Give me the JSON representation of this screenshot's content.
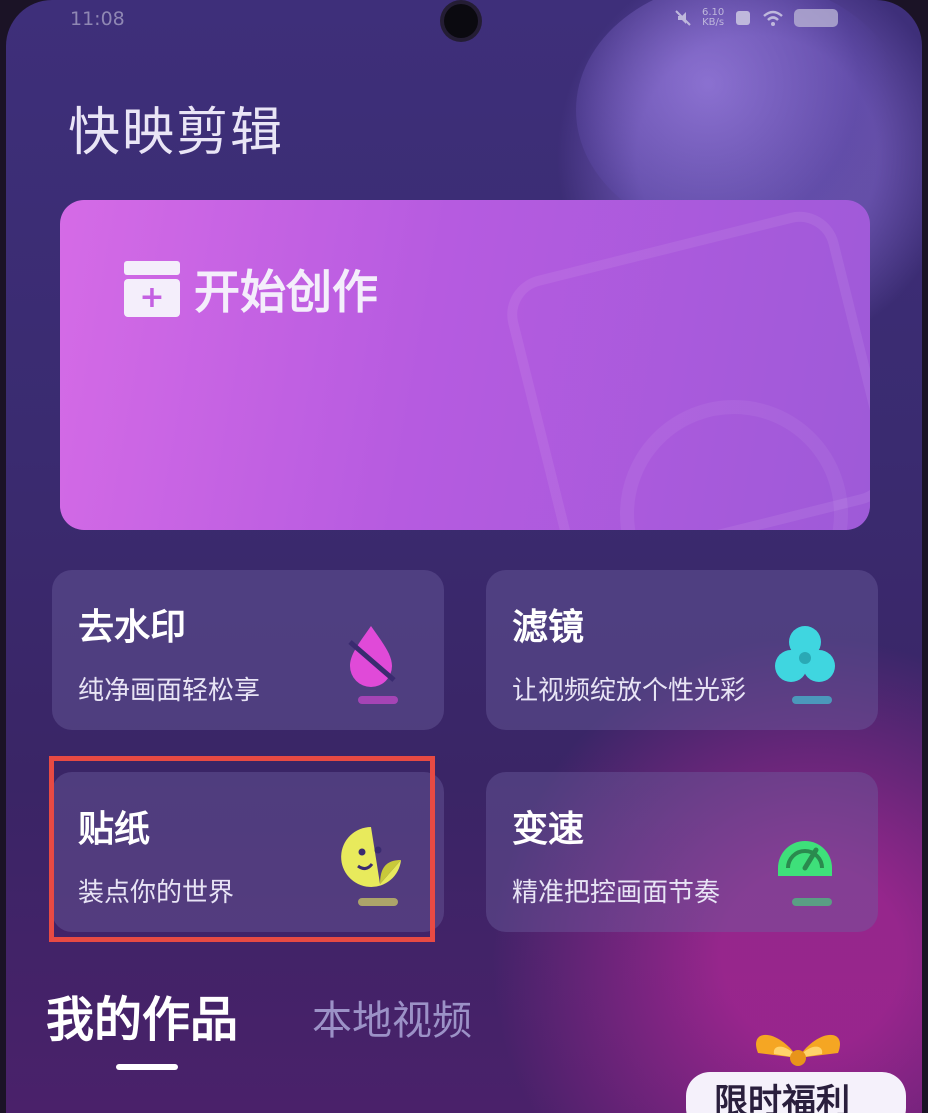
{
  "status_bar": {
    "time": "11:08",
    "net_speed_value": "6.10",
    "net_speed_unit": "KB/s"
  },
  "app": {
    "title": "快映剪辑"
  },
  "hero": {
    "label": "开始创作",
    "icon": "clapperboard-plus-icon"
  },
  "features": [
    {
      "title": "去水印",
      "subtitle": "纯净画面轻松享",
      "icon": "watermark-off-drop-icon",
      "color": "#e04ad8"
    },
    {
      "title": "滤镜",
      "subtitle": "让视频绽放个性光彩",
      "icon": "filter-circles-icon",
      "color": "#3fd6e0"
    },
    {
      "title": "贴纸",
      "subtitle": "装点你的世界",
      "icon": "sticker-face-icon",
      "color": "#e8ea5c"
    },
    {
      "title": "变速",
      "subtitle": "精准把控画面节奏",
      "icon": "speedometer-icon",
      "color": "#3ee07a"
    }
  ],
  "tabs": {
    "mine": "我的作品",
    "local": "本地视频"
  },
  "highlight_color": "#e84a43",
  "promo": {
    "label": "限时福利",
    "icon": "gift-icon"
  }
}
